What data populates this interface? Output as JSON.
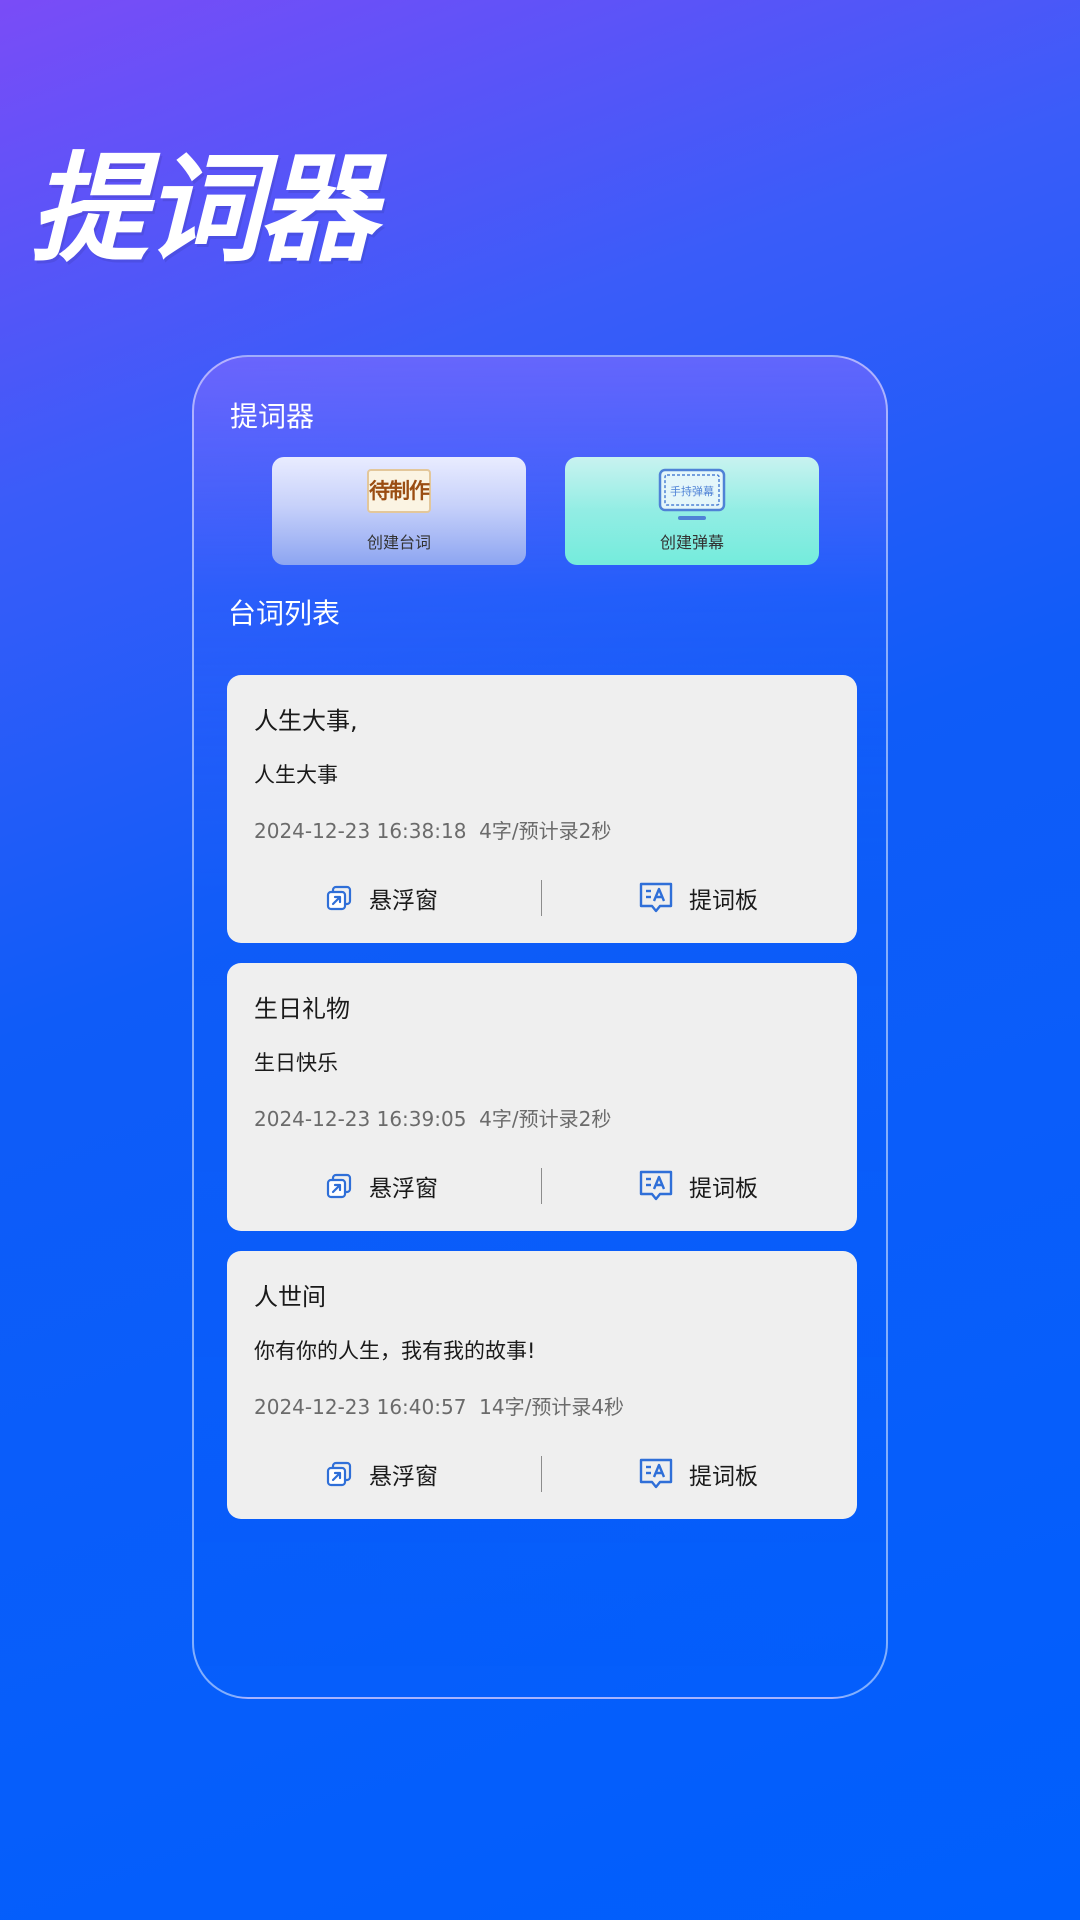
{
  "hero": {
    "title": "提词器"
  },
  "app": {
    "title": "提词器"
  },
  "actions": {
    "create_script": {
      "label": "创建台词",
      "icon_text": "待制作",
      "icon": "pending-badge-icon"
    },
    "create_danmu": {
      "label": "创建弹幕",
      "icon_text": "手持弹幕",
      "icon": "monitor-icon"
    }
  },
  "list": {
    "title": "台词列表",
    "items": [
      {
        "title": "人生大事,",
        "content": "人生大事",
        "time": "2024-12-23 16:38:18",
        "stats": "4字/预计录2秒",
        "float_label": "悬浮窗",
        "board_label": "提词板"
      },
      {
        "title": "生日礼物",
        "content": "生日快乐",
        "time": "2024-12-23 16:39:05",
        "stats": "4字/预计录2秒",
        "float_label": "悬浮窗",
        "board_label": "提词板"
      },
      {
        "title": "人世间",
        "content": "你有你的人生，我有我的故事!",
        "time": "2024-12-23 16:40:57",
        "stats": "14字/预计录4秒",
        "float_label": "悬浮窗",
        "board_label": "提词板"
      }
    ]
  },
  "colors": {
    "accent_blue": "#2f6fd8",
    "bg_top": "#7a4cf7",
    "bg_bottom": "#005ffd",
    "card_bg": "#efefef"
  }
}
